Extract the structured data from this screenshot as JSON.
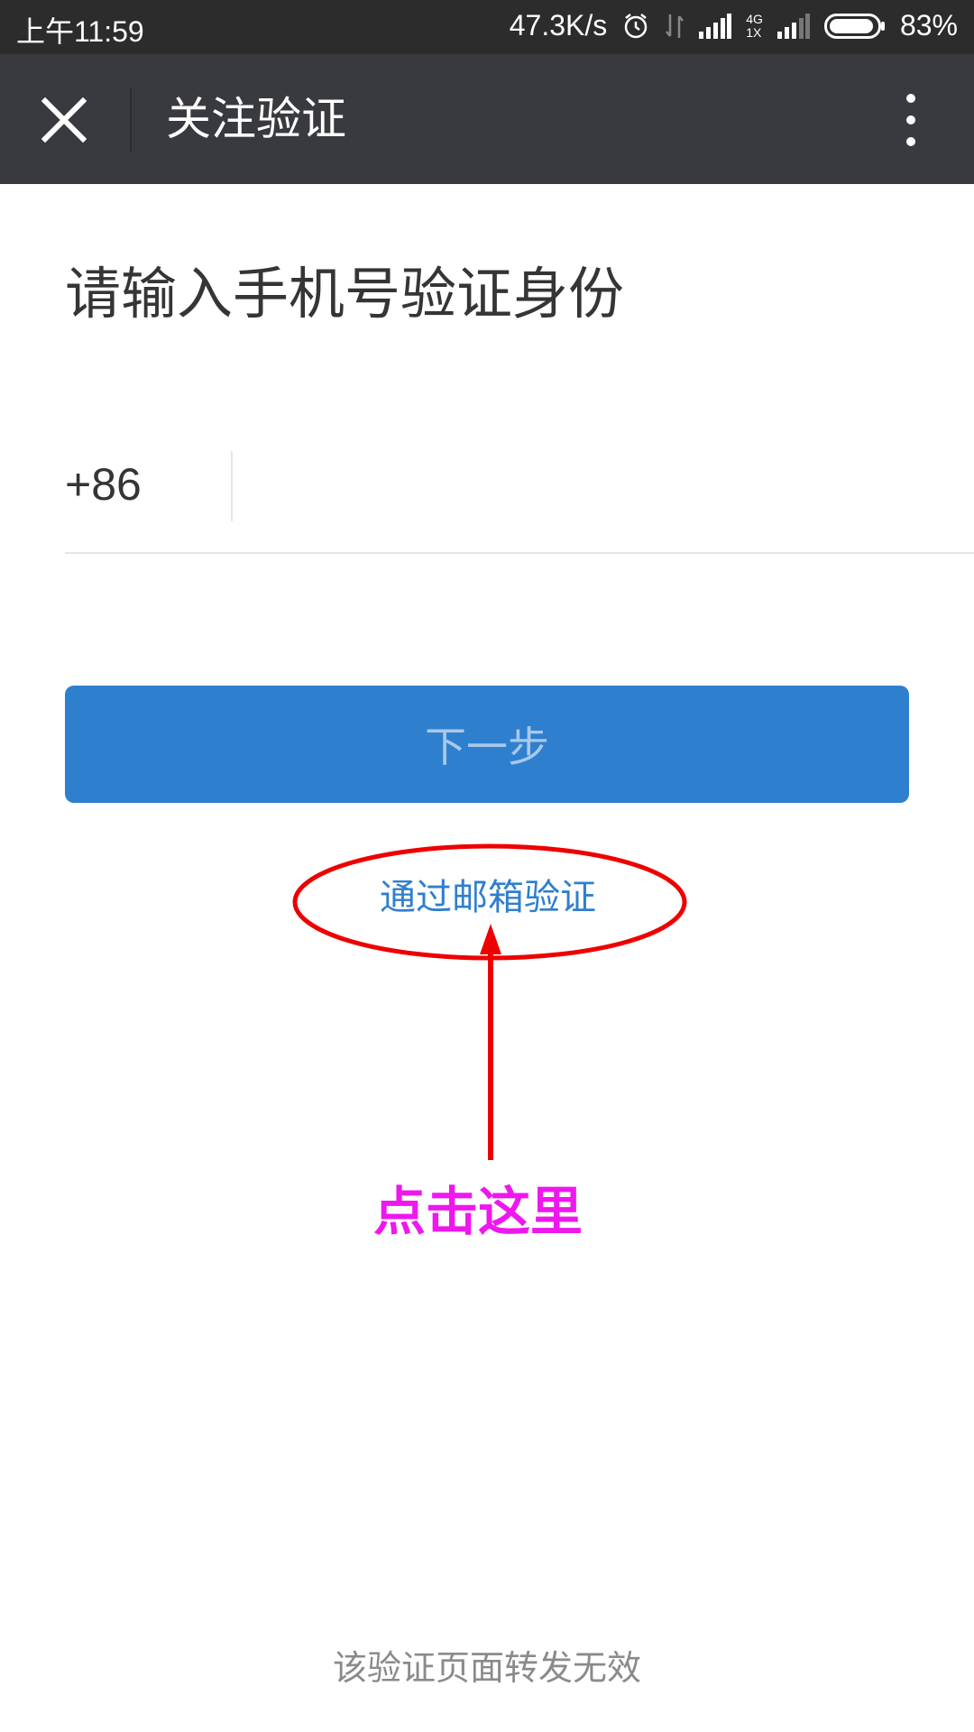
{
  "status_bar": {
    "time": "上午11:59",
    "network_speed": "47.3K/s",
    "network_type_top": "4G",
    "network_type_bottom": "1X",
    "battery": "83%",
    "icons": [
      "alarm-icon",
      "data-transfer-icon",
      "signal-icon",
      "signal-icon",
      "battery-icon"
    ]
  },
  "title_bar": {
    "title": "关注验证",
    "close_icon": "close-icon",
    "more_icon": "more-vertical-icon"
  },
  "content": {
    "heading": "请输入手机号验证身份",
    "country_code": "+86",
    "phone_value": "",
    "next_button_label": "下一步",
    "email_link_label": "通过邮箱验证",
    "footer_note": "该验证页面转发无效"
  },
  "annotation": {
    "label": "点击这里",
    "label_color": "#ee17ee",
    "marker_color": "#ee0000"
  },
  "colors": {
    "title_bar_bg": "#393a3f",
    "status_bar_bg": "#2c2c2c",
    "primary_button": "#2f7fcf",
    "link": "#2f7fcf"
  }
}
